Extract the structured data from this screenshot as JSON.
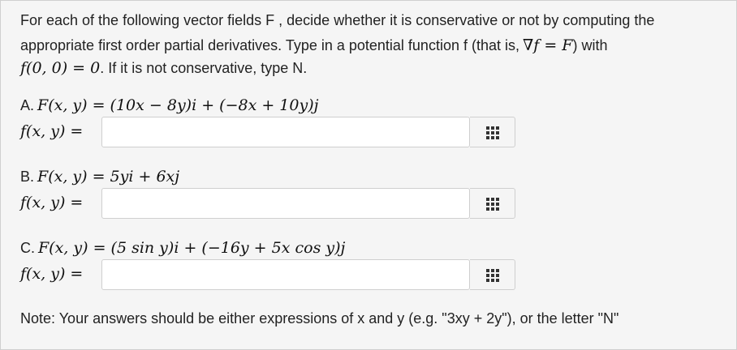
{
  "intro": {
    "line1": "For each of the following vector fields F , decide whether it is conservative or not by computing the",
    "line2_prefix": "appropriate first order partial derivatives. Type in a potential function f (that is,",
    "line2_math": "∇f = F",
    "line2_suffix": ") with",
    "line3_math": "f(0, 0) = 0",
    "line3_suffix": ". If it is not conservative, type N."
  },
  "problems": [
    {
      "letter": "A.",
      "field_expr": "F(x, y) = (10x − 8y)i + (−8x + 10y)j",
      "answer_label": "f(x, y) =",
      "answer_value": ""
    },
    {
      "letter": "B.",
      "field_expr": "F(x, y) = 5yi + 6xj",
      "answer_label": "f(x, y) =",
      "answer_value": ""
    },
    {
      "letter": "C.",
      "field_expr": "F(x, y) = (5 sin y)i + (−16y + 5x cos y)j",
      "answer_label": "f(x, y) =",
      "answer_value": ""
    }
  ],
  "palette_icon": "grid-keypad-icon",
  "note": "Note: Your answers should be either expressions of x and y (e.g. \"3xy + 2y\"), or the letter \"N\""
}
